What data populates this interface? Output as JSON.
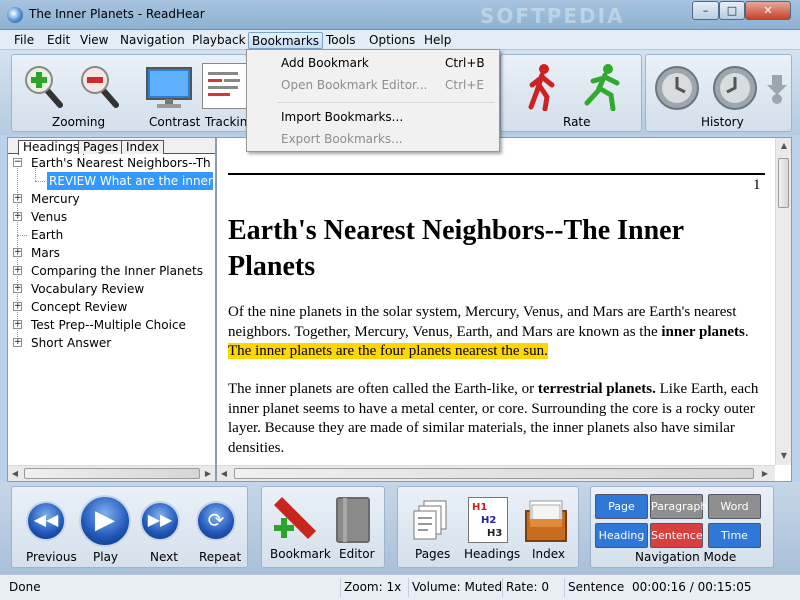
{
  "window": {
    "title": "The Inner Planets - ReadHear",
    "watermark": "SOFTPEDIA",
    "min_glyph": "–",
    "max_glyph": "□",
    "close_glyph": "✕"
  },
  "menu": {
    "file": "File",
    "edit": "Edit",
    "view": "View",
    "navigation": "Navigation",
    "playback": "Playback",
    "bookmarks": "Bookmarks",
    "tools": "Tools",
    "options": "Options",
    "help": "Help"
  },
  "bookmarks_menu": {
    "items": [
      {
        "label": "Add Bookmark",
        "shortcut": "Ctrl+B",
        "enabled": true
      },
      {
        "label": "Open Bookmark Editor...",
        "shortcut": "Ctrl+E",
        "enabled": false
      },
      {
        "label": "Import Bookmarks...",
        "shortcut": "",
        "enabled": true
      },
      {
        "label": "Export Bookmarks...",
        "shortcut": "",
        "enabled": false
      }
    ]
  },
  "toolbar": {
    "zooming": "Zooming",
    "contrast": "Contrast",
    "tracking": "Tracking",
    "rate": "Rate",
    "history": "History"
  },
  "left_tabs": {
    "headings": "Headings",
    "pages": "Pages",
    "index": "Index"
  },
  "tree": [
    {
      "label": "Earth's Nearest Neighbors--The Inner Planets",
      "expander": "−"
    },
    {
      "label": "REVIEW What are the inner planets?",
      "expander": "",
      "selected": true
    },
    {
      "label": "Mercury",
      "expander": "+"
    },
    {
      "label": "Venus",
      "expander": "+"
    },
    {
      "label": "Earth",
      "expander": ""
    },
    {
      "label": "Mars",
      "expander": "+"
    },
    {
      "label": "Comparing the Inner Planets",
      "expander": "+"
    },
    {
      "label": "Vocabulary Review",
      "expander": "+"
    },
    {
      "label": "Concept Review",
      "expander": "+"
    },
    {
      "label": "Test Prep--Multiple Choice",
      "expander": "+"
    },
    {
      "label": "Short Answer",
      "expander": "+"
    }
  ],
  "document": {
    "page_number": "1",
    "heading": "Earth's Nearest Neighbors--The Inner Planets",
    "p1_a": "Of the nine planets in the solar system, Mercury, Venus, and Mars are Earth's nearest neighbors. Together, Mercury, Venus, Earth, and Mars are known as the ",
    "p1_b": "inner planets",
    "p1_c": ".",
    "p1_hl": "The inner planets are the four planets nearest the sun.",
    "p2_a": "The inner planets are often called the Earth-like, or ",
    "p2_b": "terrestrial planets.",
    "p2_c": " Like Earth, each inner planet seems to have a metal center, or core. Surrounding the core is a rocky outer layer. Because they are made of similar materials, the inner planets also have similar densities."
  },
  "bottom": {
    "previous": "Previous",
    "play": "Play",
    "next": "Next",
    "repeat": "Repeat",
    "bookmark": "Bookmark",
    "editor": "Editor",
    "pages": "Pages",
    "headings": "Headings",
    "index": "Index",
    "nav_mode": "Navigation Mode",
    "nav_buttons": [
      "Page",
      "Paragraph",
      "Word",
      "Heading",
      "Sentence",
      "Time"
    ],
    "h1": "H1",
    "h2": "H2",
    "h3": "H3"
  },
  "status": {
    "state": "Done",
    "zoom": "Zoom: 1x",
    "volume": "Volume: Muted",
    "rate": "Rate: 0",
    "mode": "Sentence",
    "time": "00:00:16 / 00:15:05"
  },
  "colors": {
    "selection": "#3399ff",
    "highlight": "#ffd700",
    "nav_blue": "#2f78d8",
    "nav_red": "#d84040",
    "nav_gray": "#8f8f8f"
  }
}
